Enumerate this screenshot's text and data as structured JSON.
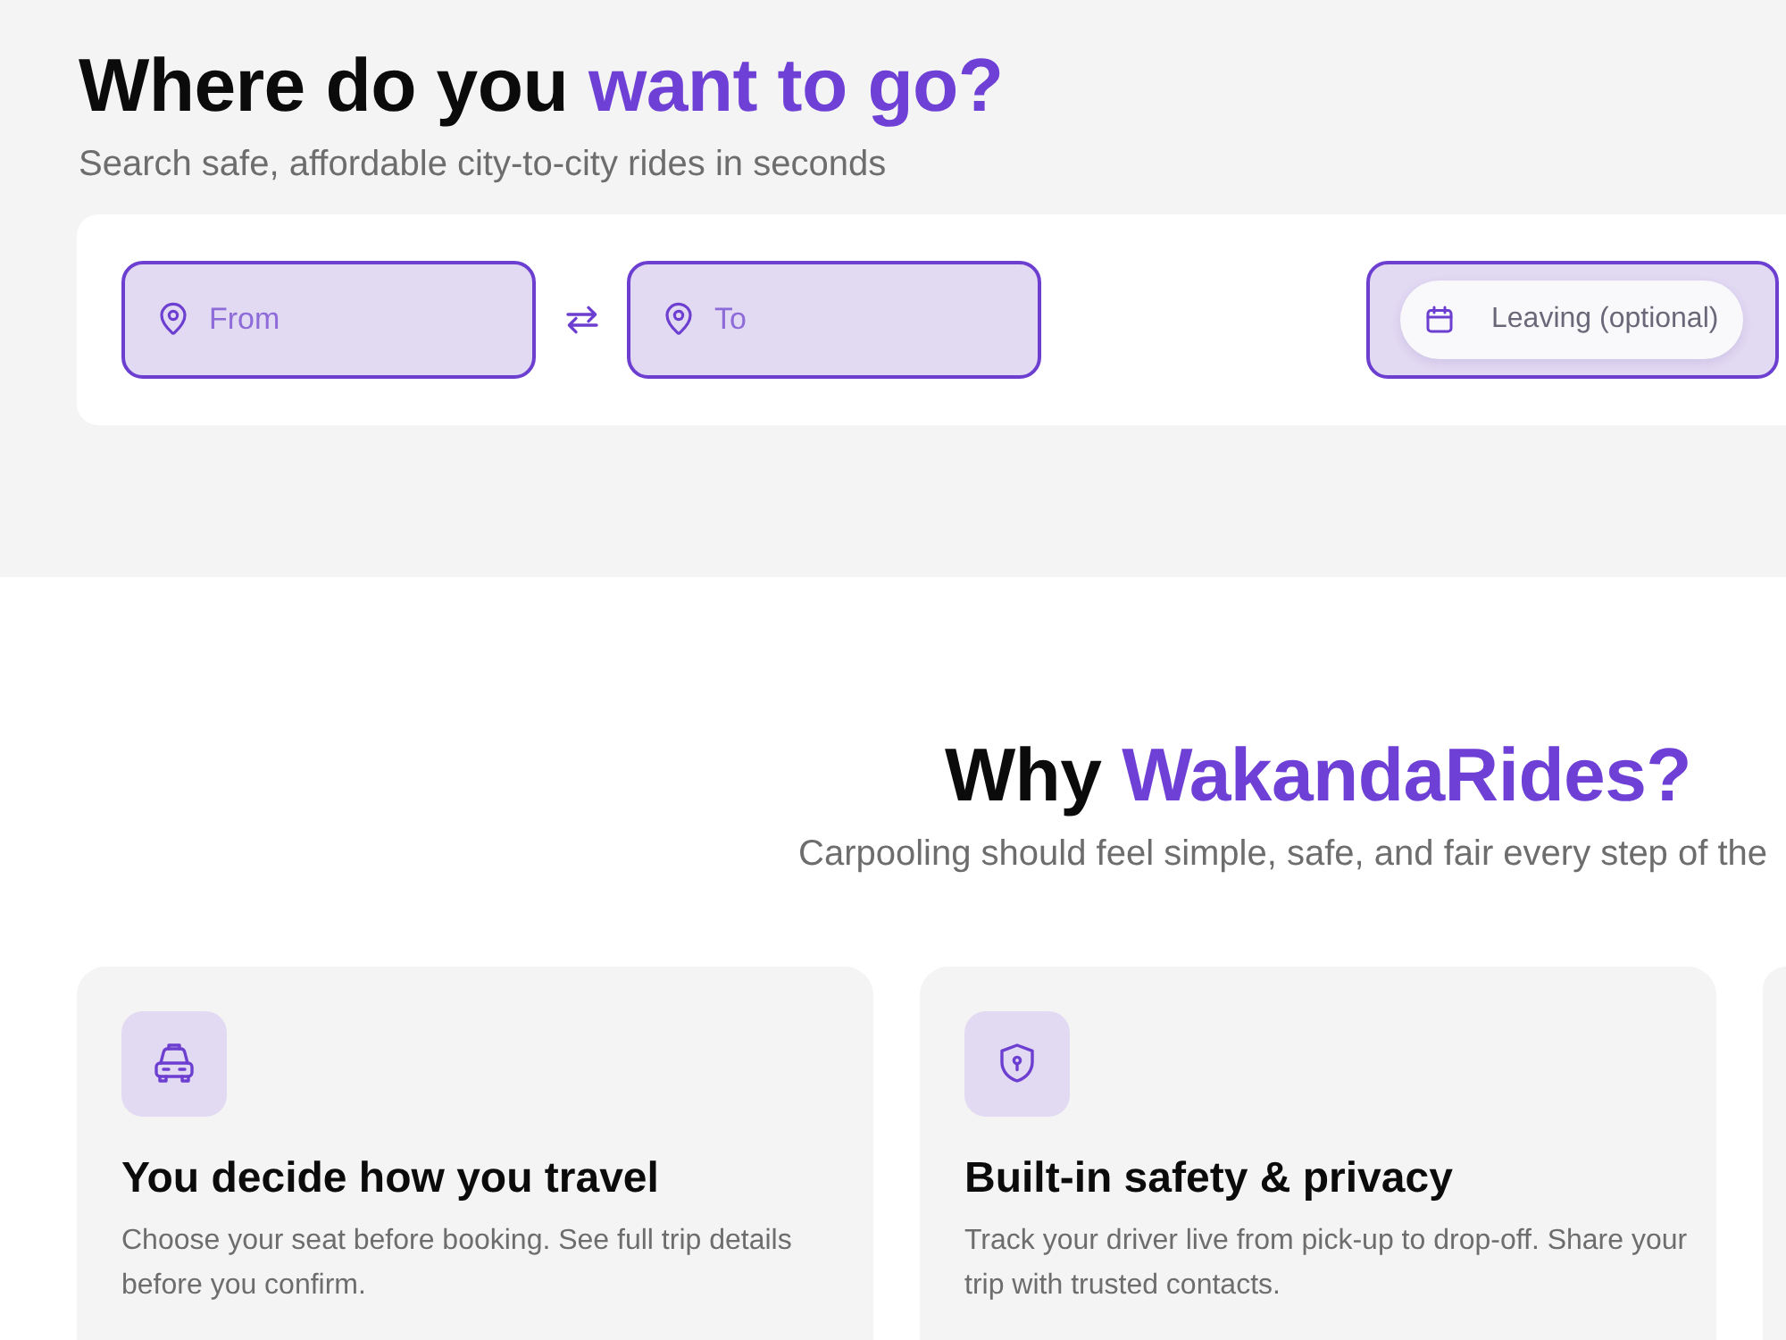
{
  "hero": {
    "heading": {
      "lead": "Where do you",
      "accent": "want to go?"
    },
    "subtitle": "Search safe, affordable city-to-city rides in seconds",
    "search": {
      "from": {
        "placeholder": "From"
      },
      "to": {
        "placeholder": "To"
      },
      "leaving": {
        "placeholder": "Leaving (optional)"
      }
    }
  },
  "why": {
    "heading": {
      "lead": "Why",
      "accent": "WakandaRides?"
    },
    "subtitle": "Carpooling should feel simple, safe, and fair every step of the",
    "features": [
      {
        "title": "You decide how you travel",
        "text": "Choose your seat before booking. See full trip details before you confirm."
      },
      {
        "title": "Built-in safety & privacy",
        "text": "Track your driver live from pick-up to drop-off. Share your trip with trusted contacts."
      }
    ]
  }
}
